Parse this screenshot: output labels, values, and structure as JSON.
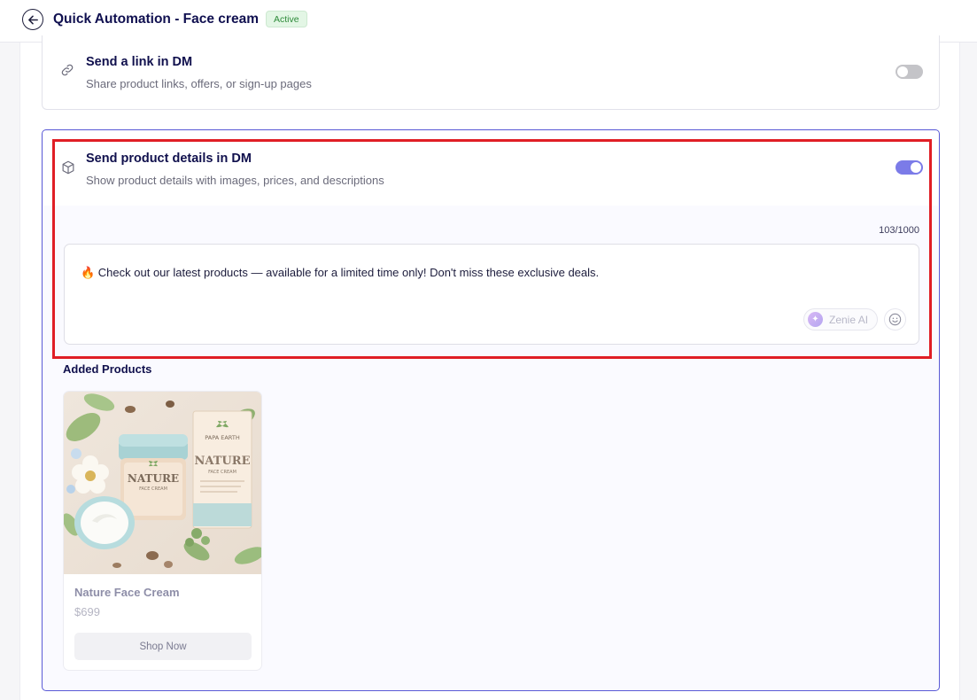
{
  "header": {
    "title": "Quick Automation - Face cream",
    "status": "Active"
  },
  "options": {
    "link": {
      "title": "Send a link in DM",
      "subtitle": "Share product links, offers, or sign-up pages",
      "enabled": false
    },
    "product": {
      "title": "Send product details in DM",
      "subtitle": "Show product details with images, prices, and descriptions",
      "enabled": true
    }
  },
  "message": {
    "counter": "103/1000",
    "text": "🔥 Check out our latest products — available for a limited time only! Don't miss these exclusive deals.",
    "ai_button": "Zenie AI"
  },
  "added_products": {
    "label": "Added Products",
    "items": [
      {
        "name": "Nature Face Cream",
        "price": "$699",
        "button": "Shop Now",
        "image_text": {
          "brand": "PAPA EARTH",
          "box_title": "NATURE",
          "box_subtitle": "FACE CREAM",
          "jar_title": "NATURE",
          "jar_subtitle": "FACE CREAM"
        }
      }
    ]
  },
  "colors": {
    "accent": "#5a5ad6",
    "toggle_on": "#7b7be8",
    "highlight": "#e01e25",
    "badge_bg": "#e3f6e5",
    "badge_text": "#2e8b3a"
  }
}
